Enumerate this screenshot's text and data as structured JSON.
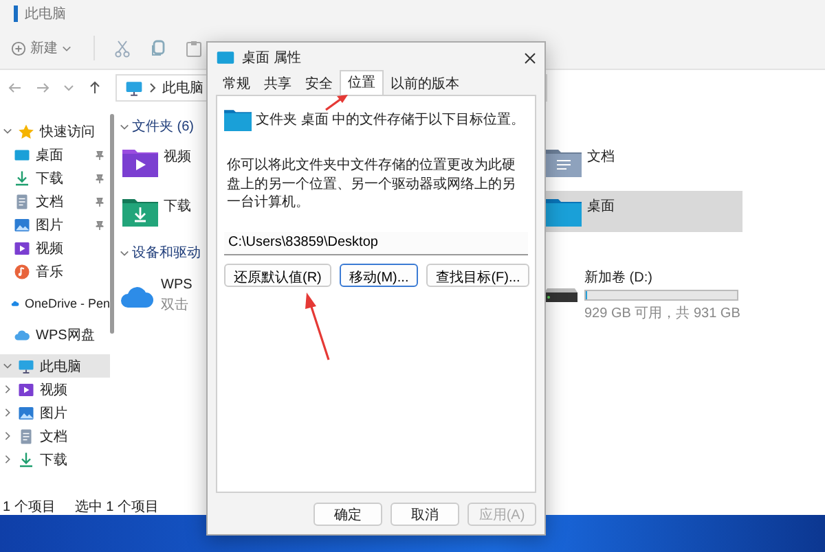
{
  "explorer": {
    "title": "此电脑",
    "toolbar": {
      "new_label": "新建"
    },
    "address": {
      "path": "此电脑"
    },
    "nav": [
      {
        "label": "快速访问",
        "kind": "star",
        "selected": false,
        "expanded": true,
        "children": [
          {
            "label": "桌面",
            "kind": "desktop",
            "selected": false,
            "pinned": true
          },
          {
            "label": "下载",
            "kind": "download",
            "selected": false,
            "pinned": true
          },
          {
            "label": "文档",
            "kind": "document",
            "selected": false,
            "pinned": true
          },
          {
            "label": "图片",
            "kind": "picture",
            "selected": false,
            "pinned": true
          },
          {
            "label": "视频",
            "kind": "video",
            "selected": false,
            "pinned": false
          },
          {
            "label": "音乐",
            "kind": "music",
            "selected": false,
            "pinned": false
          }
        ]
      },
      {
        "label": "OneDrive - Pen",
        "kind": "cloud",
        "selected": false
      },
      {
        "label": "WPS网盘",
        "kind": "cloud2",
        "selected": false
      },
      {
        "label": "此电脑",
        "kind": "pc",
        "selected": true,
        "expanded": true,
        "children": [
          {
            "label": "视频",
            "kind": "video",
            "selected": false,
            "expanded": false
          },
          {
            "label": "图片",
            "kind": "picture",
            "selected": false,
            "expanded": false
          },
          {
            "label": "文档",
            "kind": "document",
            "selected": false,
            "expanded": false
          },
          {
            "label": "下载",
            "kind": "download",
            "selected": false,
            "expanded": false
          }
        ]
      }
    ],
    "folders": {
      "header": "文件夹 (6)",
      "items": [
        {
          "name": "视频",
          "kind": "video",
          "selected": false
        },
        {
          "name": "下载",
          "kind": "download",
          "selected": false
        },
        {
          "name": "文档",
          "kind": "document",
          "selected": false
        },
        {
          "name": "桌面",
          "kind": "desktop",
          "selected": true
        }
      ]
    },
    "devices": {
      "header": "设备和驱动",
      "items": [
        {
          "name": "WPS",
          "subtitle": "双击",
          "kind": "cloud"
        },
        {
          "name": "新加卷 (D:)",
          "kind": "drive",
          "level": 0.002,
          "detail": "929 GB 可用，共 931 GB"
        }
      ]
    },
    "status": [
      "1 个项目",
      "选中 1 个项目"
    ]
  },
  "dialog": {
    "title": "桌面 属性",
    "tabs": [
      {
        "label": "常规",
        "selected": false
      },
      {
        "label": "共享",
        "selected": false
      },
      {
        "label": "安全",
        "selected": false
      },
      {
        "label": "位置",
        "selected": true
      },
      {
        "label": "以前的版本",
        "selected": false
      }
    ],
    "info": "文件夹 桌面 中的文件存储于以下目标位置。",
    "description": "你可以将此文件夹中文件存储的位置更改为此硬盘上的另一个位置、另一个驱动器或网络上的另一台计算机。",
    "path": "C:\\Users\\83859\\Desktop",
    "location_buttons": [
      {
        "label": "还原默认值(R)",
        "focused": false
      },
      {
        "label": "移动(M)...",
        "focused": true
      },
      {
        "label": "查找目标(F)...",
        "focused": false
      }
    ],
    "footer_buttons": [
      {
        "label": "确定",
        "disabled": false
      },
      {
        "label": "取消",
        "disabled": false
      },
      {
        "label": "应用(A)",
        "disabled": true
      }
    ]
  }
}
